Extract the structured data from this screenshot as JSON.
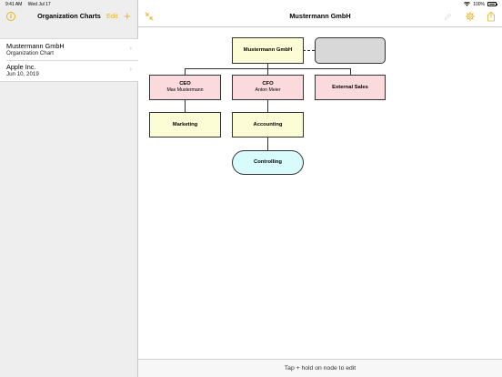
{
  "status_bar": {
    "time": "9:41 AM",
    "date": "Wed Jul 17",
    "battery": "100%"
  },
  "sidebar": {
    "title": "Organization Charts",
    "edit_label": "Edit",
    "add_label": "+",
    "info_glyph": "i",
    "items": [
      {
        "title": "Mustermann GmbH",
        "subtitle": "Organization Chart"
      },
      {
        "title": "Apple Inc.",
        "subtitle": "Jun 10, 2019"
      }
    ],
    "chevron": "›"
  },
  "header": {
    "title": "Mustermann GmbH"
  },
  "chart": {
    "root": {
      "name": "Mustermann GmbH"
    },
    "ceo": {
      "name": "CEO",
      "person": "Max Mustermann"
    },
    "cfo": {
      "name": "CFO",
      "person": "Anton Meier"
    },
    "sales": {
      "name": "External Sales"
    },
    "marketing": {
      "name": "Marketing"
    },
    "accounting": {
      "name": "Accounting"
    },
    "controlling": {
      "name": "Controlling"
    }
  },
  "footer": {
    "hint": "Tap + hold on node to edit"
  },
  "colors": {
    "accent": "#e6b422",
    "root_fill": "#fdfdd5",
    "exec_fill": "#fadadd",
    "dept_fill": "#fdfdd5",
    "staff_fill": "#d8fbfb",
    "assistant_fill": "#d8d8d8"
  }
}
